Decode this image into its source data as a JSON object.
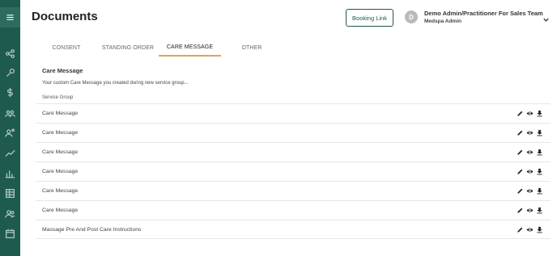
{
  "header": {
    "title": "Documents",
    "booking_link_label": "Booking Link",
    "user": {
      "initial": "D",
      "name": "Demo Admin/Practitioner For Sales Team",
      "role": "Medspa Admin"
    }
  },
  "sidebar": {
    "items": [
      {
        "icon": "menu-icon"
      },
      {
        "icon": "share-icon"
      },
      {
        "icon": "wrench-icon"
      },
      {
        "icon": "dollar-icon"
      },
      {
        "icon": "team-icon"
      },
      {
        "icon": "user-settings-icon"
      },
      {
        "icon": "trend-icon"
      },
      {
        "icon": "bar-chart-icon"
      },
      {
        "icon": "table-icon"
      },
      {
        "icon": "users-icon"
      },
      {
        "icon": "calendar-icon"
      }
    ]
  },
  "tabs": [
    {
      "label": "CONSENT",
      "active": false
    },
    {
      "label": "STANDING ORDER",
      "active": false
    },
    {
      "label": "CARE MESSAGE",
      "active": true
    },
    {
      "label": "OTHER",
      "active": false
    }
  ],
  "section": {
    "title": "Care Message",
    "description": "Your custom Care Message you created during new service group...",
    "column_header": "Service Group"
  },
  "rows": [
    {
      "name": "Care Message"
    },
    {
      "name": "Care Message"
    },
    {
      "name": "Care Message"
    },
    {
      "name": "Care Message"
    },
    {
      "name": "Care Message"
    },
    {
      "name": "Care Message"
    },
    {
      "name": "Massage Pre And Post Care Instructions"
    }
  ],
  "colors": {
    "sidebar": "#1f5a4e",
    "accent_tab": "#e1a35b",
    "brand": "#1f5a4e"
  }
}
